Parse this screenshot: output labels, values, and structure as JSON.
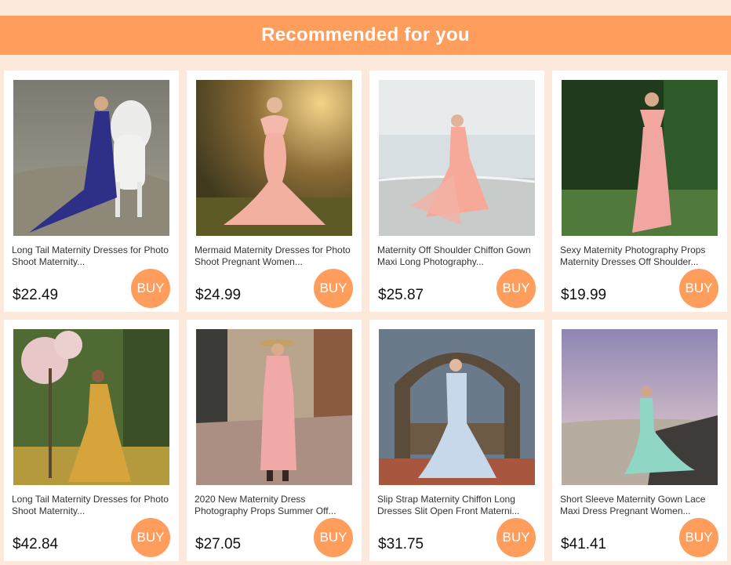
{
  "header": {
    "title": "Recommended for you"
  },
  "colors": {
    "accent": "#ff9d5c",
    "background": "#fde9db",
    "card": "#ffffff"
  },
  "buy_label": "BUY",
  "products": [
    {
      "title": "Long Tail Maternity Dresses for Photo Shoot Maternity...",
      "price": "$22.49",
      "image": "woman-in-blue-gown-with-white-horse"
    },
    {
      "title": "Mermaid Maternity Dresses for Photo Shoot Pregnant Women...",
      "price": "$24.99",
      "image": "woman-in-pink-mermaid-dress-in-forest"
    },
    {
      "title": "Maternity Off Shoulder Chiffon Gown Maxi Long Photography...",
      "price": "$25.87",
      "image": "woman-in-pink-chiffon-on-beach"
    },
    {
      "title": "Sexy Maternity Photography Props Maternity Dresses Off Shoulder...",
      "price": "$19.99",
      "image": "woman-in-pink-gown-in-green-field"
    },
    {
      "title": "Long Tail Maternity Dresses for Photo Shoot Maternity...",
      "price": "$42.84",
      "image": "woman-in-yellow-gown-under-blossom-tree"
    },
    {
      "title": "2020 New Maternity Dress Photography Props Summer Off...",
      "price": "$27.05",
      "image": "woman-in-pink-lace-dress-with-hat-on-brick-path"
    },
    {
      "title": "Slip Strap Maternity Chiffon Long Dresses Slit Open Front Materni...",
      "price": "$31.75",
      "image": "woman-in-light-blue-mermaid-gown-in-garden"
    },
    {
      "title": "Short Sleeve Maternity Gown Lace Maxi Dress Pregnant Women...",
      "price": "$41.41",
      "image": "woman-in-mint-tulle-gown-on-rocky-shore"
    }
  ]
}
